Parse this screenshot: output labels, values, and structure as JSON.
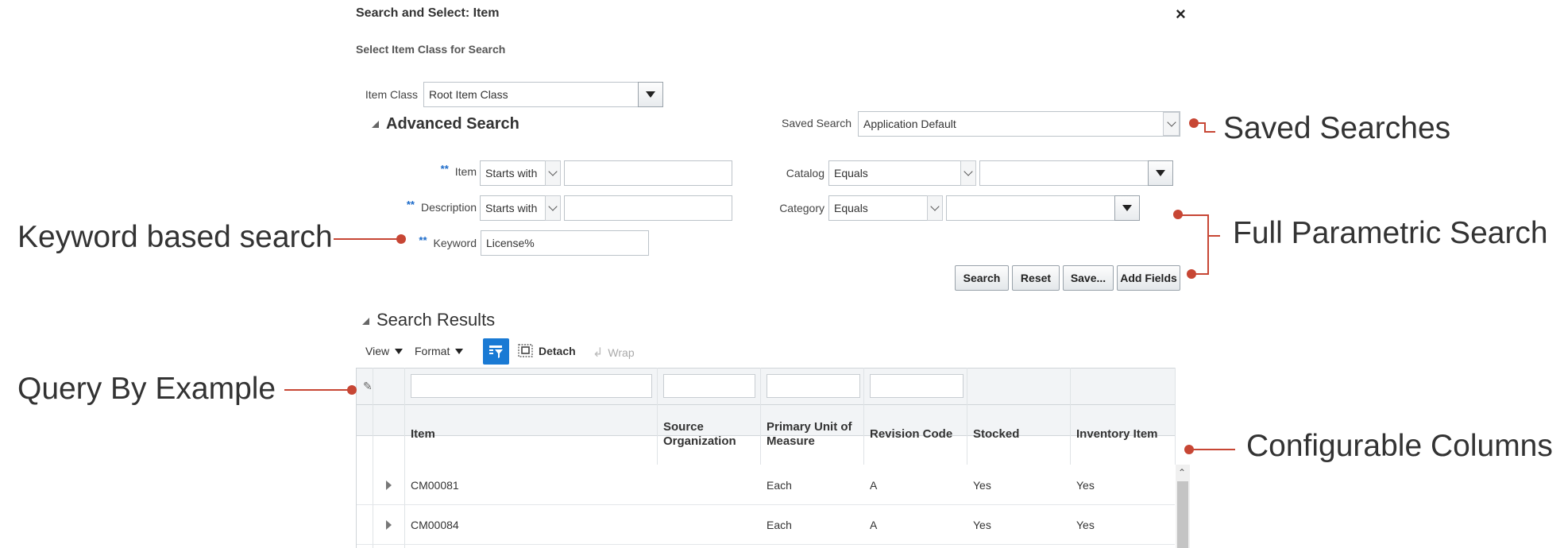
{
  "dialog": {
    "title": "Search and Select: Item",
    "close_symbol": "×",
    "subtitle": "Select Item Class for Search"
  },
  "item_class": {
    "label": "Item Class",
    "value": "Root Item Class"
  },
  "advanced_search": {
    "title": "Advanced Search",
    "required_marker": "**",
    "saved_search": {
      "label": "Saved Search",
      "value": "Application Default"
    },
    "item": {
      "label": "Item",
      "operator": "Starts with",
      "value": ""
    },
    "description": {
      "label": "Description",
      "operator": "Starts with",
      "value": ""
    },
    "keyword": {
      "label": "Keyword",
      "value": "License%"
    },
    "catalog": {
      "label": "Catalog",
      "operator": "Equals",
      "value": ""
    },
    "category": {
      "label": "Category",
      "operator": "Equals",
      "value": ""
    },
    "buttons": {
      "search": "Search",
      "reset": "Reset",
      "save": "Save...",
      "add_fields": "Add Fields"
    }
  },
  "results": {
    "title": "Search Results",
    "toolbar": {
      "view": "View",
      "format": "Format",
      "detach": "Detach",
      "wrap": "Wrap"
    },
    "columns": {
      "item": "Item",
      "source_org_line1": "Source",
      "source_org_line2": "Organization",
      "uom_line1": "Primary Unit of",
      "uom_line2": "Measure",
      "revision": "Revision Code",
      "stocked": "Stocked",
      "inventory": "Inventory Item"
    },
    "rows": [
      {
        "item": "CM00081",
        "source_org": "",
        "uom": "Each",
        "revision": "A",
        "stocked": "Yes",
        "inventory": "Yes"
      },
      {
        "item": "CM00084",
        "source_org": "",
        "uom": "Each",
        "revision": "A",
        "stocked": "Yes",
        "inventory": "Yes"
      }
    ]
  },
  "annotations": {
    "saved_searches": "Saved Searches",
    "full_parametric": "Full Parametric Search",
    "keyword_based": "Keyword based search",
    "query_by_example": "Query By Example",
    "configurable_columns": "Configurable Columns",
    "color": "#c74634"
  },
  "icons": {
    "dropdown": "caret-down-icon",
    "collapse": "disclosure-triangle-icon",
    "qbe": "query-by-example-icon",
    "detach": "detach-icon",
    "wrap": "wrap-icon",
    "clear_filter": "clear-filter-icon",
    "row_expand": "row-expand-icon",
    "scroll_up": "scroll-up-icon"
  },
  "colors": {
    "accent_blue": "#1a7ad4",
    "required_blue": "#1b6ac9"
  }
}
